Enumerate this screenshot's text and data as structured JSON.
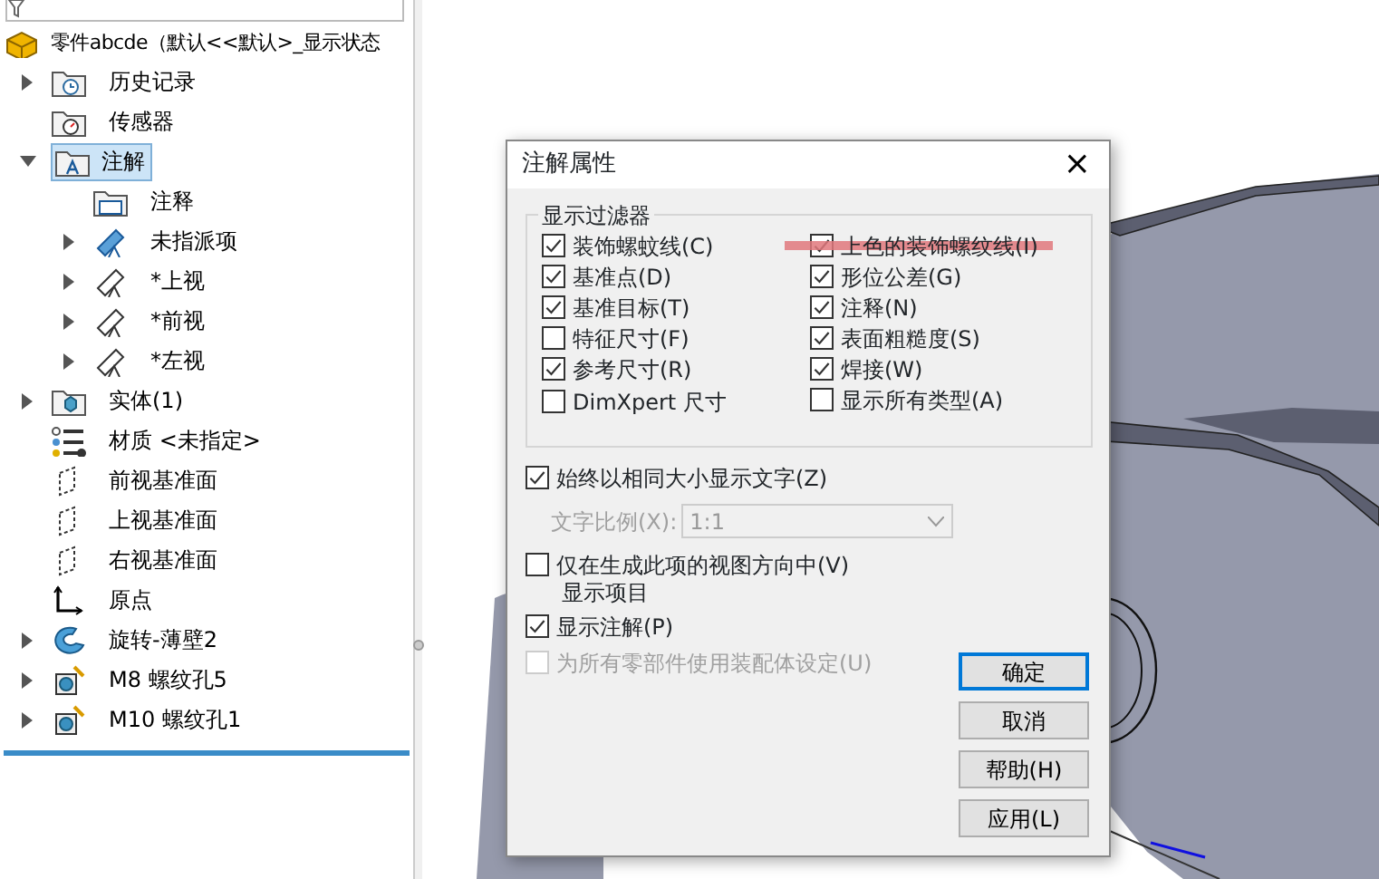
{
  "tree": {
    "root": {
      "label": "零件abcde（默认<<默认>_显示状态",
      "kind": "part"
    },
    "items": [
      {
        "label": "历史记录",
        "kind": "history",
        "expanded": false,
        "selected": false
      },
      {
        "label": "传感器",
        "kind": "sensor",
        "selected": false
      },
      {
        "label": "注解",
        "kind": "annotations",
        "expanded": true,
        "selected": true,
        "children": [
          {
            "label": "注释",
            "kind": "notes",
            "selected": false
          },
          {
            "label": "未指派项",
            "kind": "view-blue",
            "expanded": false,
            "selected": false
          },
          {
            "label": "*上视",
            "kind": "view",
            "expanded": false,
            "selected": false
          },
          {
            "label": "*前视",
            "kind": "view",
            "expanded": false,
            "selected": false
          },
          {
            "label": "*左视",
            "kind": "view",
            "expanded": false,
            "selected": false
          }
        ]
      },
      {
        "label": "实体(1)",
        "kind": "solid",
        "expanded": false,
        "selected": false
      },
      {
        "label": "材质 <未指定>",
        "kind": "material",
        "selected": false
      },
      {
        "label": "前视基准面",
        "kind": "plane",
        "selected": false
      },
      {
        "label": "上视基准面",
        "kind": "plane",
        "selected": false
      },
      {
        "label": "右视基准面",
        "kind": "plane",
        "selected": false
      },
      {
        "label": "原点",
        "kind": "origin",
        "selected": false
      },
      {
        "label": "旋转-薄壁2",
        "kind": "revolve",
        "expanded": false,
        "selected": false
      },
      {
        "label": "M8 螺纹孔5",
        "kind": "hole",
        "expanded": false,
        "selected": false
      },
      {
        "label": "M10 螺纹孔1",
        "kind": "hole",
        "expanded": false,
        "selected": false
      }
    ]
  },
  "dialog": {
    "title": "注解属性",
    "close": "×",
    "filter": {
      "legend": "显示过滤器",
      "left": [
        {
          "label": "装饰螺蚊线(C)",
          "checked": true
        },
        {
          "label": "基准点(D)",
          "checked": true
        },
        {
          "label": "基准目标(T)",
          "checked": true
        },
        {
          "label": "特征尺寸(F)",
          "checked": false
        },
        {
          "label": "参考尺寸(R)",
          "checked": true
        },
        {
          "label": "DimXpert 尺寸",
          "checked": false
        }
      ],
      "right": [
        {
          "label": "上色的装饰螺纹线(I)",
          "checked": true,
          "highlighted": true
        },
        {
          "label": "形位公差(G)",
          "checked": true,
          "highlighted": false
        },
        {
          "label": "注释(N)",
          "checked": true,
          "highlighted": false
        },
        {
          "label": "表面粗糙度(S)",
          "checked": true,
          "highlighted": false
        },
        {
          "label": "焊接(W)",
          "checked": true,
          "highlighted": false
        },
        {
          "label": "显示所有类型(A)",
          "checked": false,
          "highlighted": false
        }
      ]
    },
    "same_size": {
      "label": "始终以相同大小显示文字(Z)",
      "checked": true,
      "disabled": false
    },
    "text_scale": {
      "label": "文字比例(X):",
      "value": "1:1",
      "disabled": true
    },
    "view_only": {
      "label": "仅在生成此项的视图方向中(V)",
      "label_line2": "显示项目",
      "checked": false,
      "disabled": false
    },
    "show_annotations": {
      "label": "显示注解(P)",
      "checked": true,
      "disabled": false
    },
    "assembly_settings": {
      "label": "为所有零部件使用装配体设定(U)",
      "checked": false,
      "disabled": true
    },
    "buttons": [
      {
        "label": "确定",
        "default": true
      },
      {
        "label": "取消",
        "default": false
      },
      {
        "label": "帮助(H)",
        "default": false
      },
      {
        "label": "应用(L)",
        "default": false
      }
    ]
  }
}
